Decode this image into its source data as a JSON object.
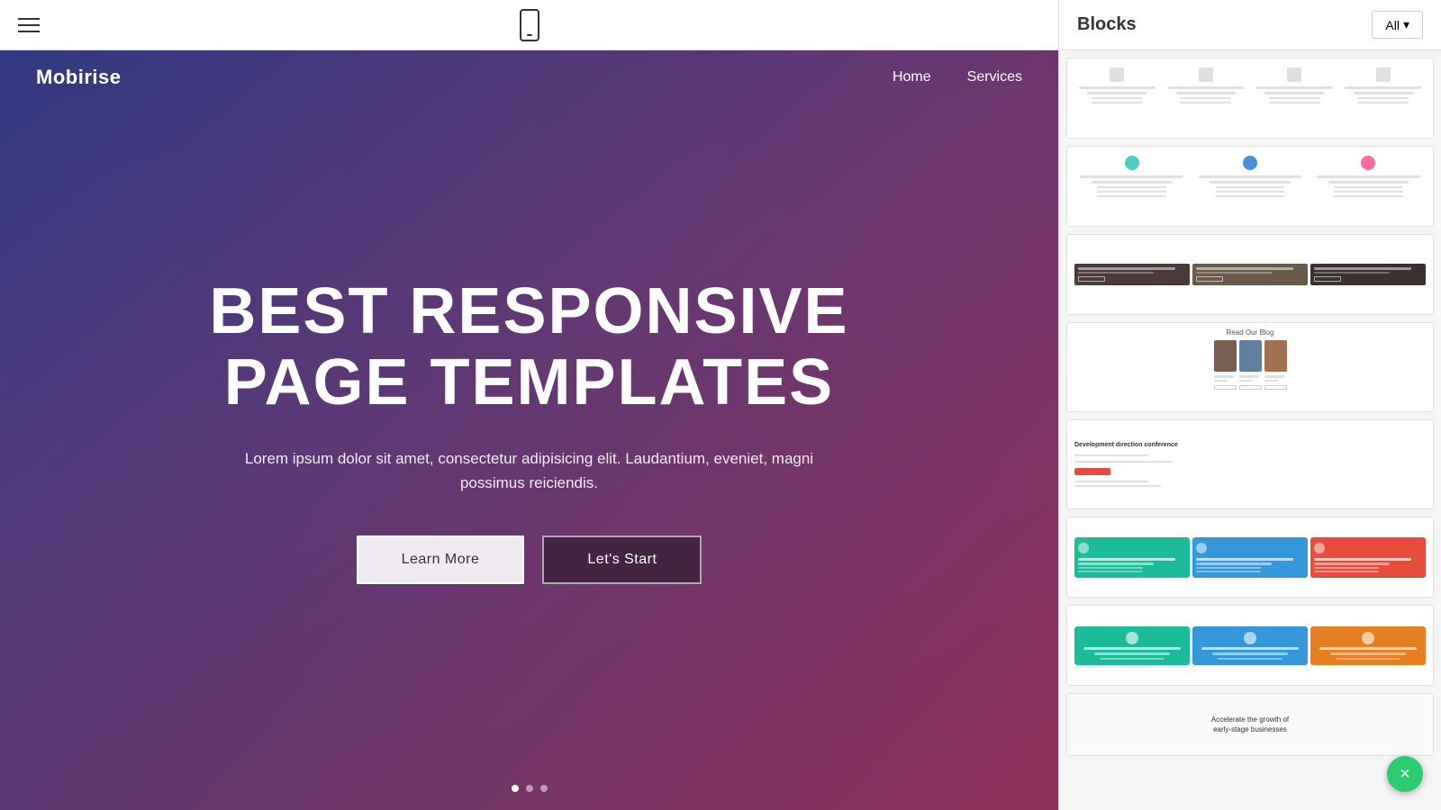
{
  "topbar": {
    "hamburger_label": "menu",
    "phone_label": "mobile preview"
  },
  "hero": {
    "brand": "Mobirise",
    "nav_home": "Home",
    "nav_services": "Services",
    "title_line1": "BEST RESPONSIVE",
    "title_line2": "PAGE TEMPLATES",
    "subtitle": "Lorem ipsum dolor sit amet, consectetur adipisicing elit. Laudantium, eveniet, magni possimus reiciendis.",
    "btn_learn_more": "Learn More",
    "btn_lets_start": "Let's Start"
  },
  "sidebar": {
    "title": "Blocks",
    "all_button": "All",
    "blocks": [
      {
        "id": "block-1",
        "type": "services-icons"
      },
      {
        "id": "block-2",
        "type": "services-circles"
      },
      {
        "id": "block-3",
        "type": "photo-grid"
      },
      {
        "id": "block-4",
        "type": "blog-grid",
        "label": "Read Our Blog"
      },
      {
        "id": "block-5",
        "type": "conference"
      },
      {
        "id": "block-6",
        "type": "colored-services"
      },
      {
        "id": "block-7",
        "type": "icon-services"
      },
      {
        "id": "block-8",
        "type": "accelerate",
        "label": "Accelerate the growth of early-stage businesses"
      }
    ]
  },
  "close_button": "×"
}
